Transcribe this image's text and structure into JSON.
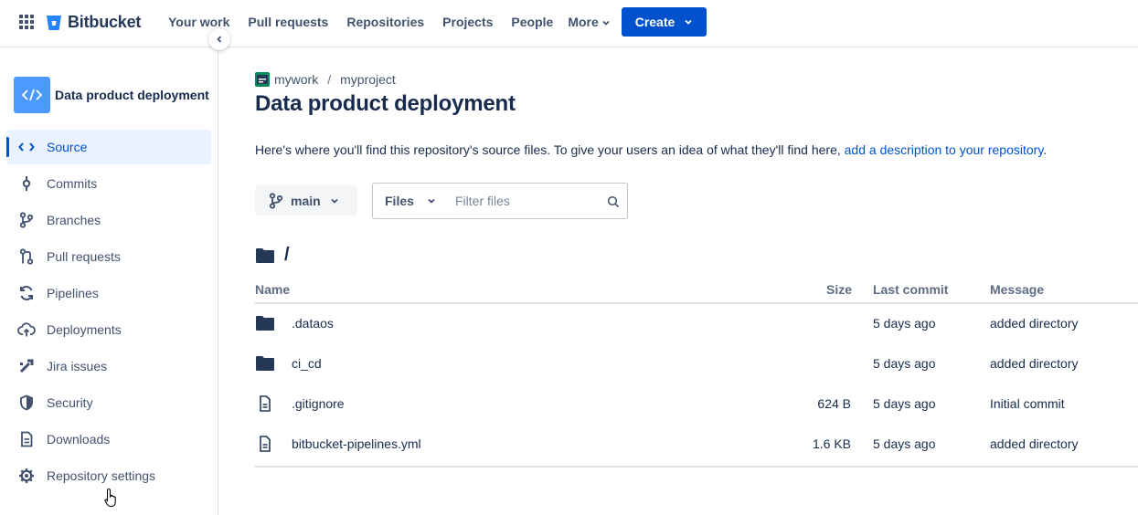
{
  "nav": {
    "brand": "Bitbucket",
    "items": [
      "Your work",
      "Pull requests",
      "Repositories",
      "Projects",
      "People"
    ],
    "more_label": "More",
    "create_label": "Create"
  },
  "sidebar": {
    "repo_name": "Data product deployment",
    "items": [
      {
        "label": "Source",
        "icon": "code-icon"
      },
      {
        "label": "Commits",
        "icon": "commit-icon"
      },
      {
        "label": "Branches",
        "icon": "branch-icon"
      },
      {
        "label": "Pull requests",
        "icon": "pull-request-icon"
      },
      {
        "label": "Pipelines",
        "icon": "pipelines-icon"
      },
      {
        "label": "Deployments",
        "icon": "cloud-upload-icon"
      },
      {
        "label": "Jira issues",
        "icon": "jira-icon"
      },
      {
        "label": "Security",
        "icon": "shield-icon"
      },
      {
        "label": "Downloads",
        "icon": "document-icon"
      },
      {
        "label": "Repository settings",
        "icon": "gear-icon"
      }
    ]
  },
  "breadcrumb": {
    "workspace": "mywork",
    "separator": "/",
    "project": "myproject"
  },
  "page": {
    "title": "Data product deployment",
    "description_prefix": "Here's where you'll find this repository's source files. To give your users an idea of what they'll find here, ",
    "description_link": "add a description to your repository",
    "description_suffix": "."
  },
  "controls": {
    "branch": "main",
    "files_label": "Files",
    "filter_placeholder": "Filter files"
  },
  "path": "/",
  "table": {
    "headers": {
      "name": "Name",
      "size": "Size",
      "last_commit": "Last commit",
      "message": "Message"
    },
    "rows": [
      {
        "type": "folder",
        "name": ".dataos",
        "size": "",
        "last_commit": "5 days ago",
        "message": "added directory"
      },
      {
        "type": "folder",
        "name": "ci_cd",
        "size": "",
        "last_commit": "5 days ago",
        "message": "added directory"
      },
      {
        "type": "file",
        "name": ".gitignore",
        "size": "624 B",
        "last_commit": "5 days ago",
        "message": "Initial commit"
      },
      {
        "type": "file",
        "name": "bitbucket-pipelines.yml",
        "size": "1.6 KB",
        "last_commit": "5 days ago",
        "message": "added directory"
      }
    ]
  },
  "colors": {
    "brand_blue": "#0052cc",
    "repo_avatar": "#4c9aff",
    "text_primary": "#172b4d",
    "text_secondary": "#42526e",
    "active_bg": "#ebf2ff"
  }
}
